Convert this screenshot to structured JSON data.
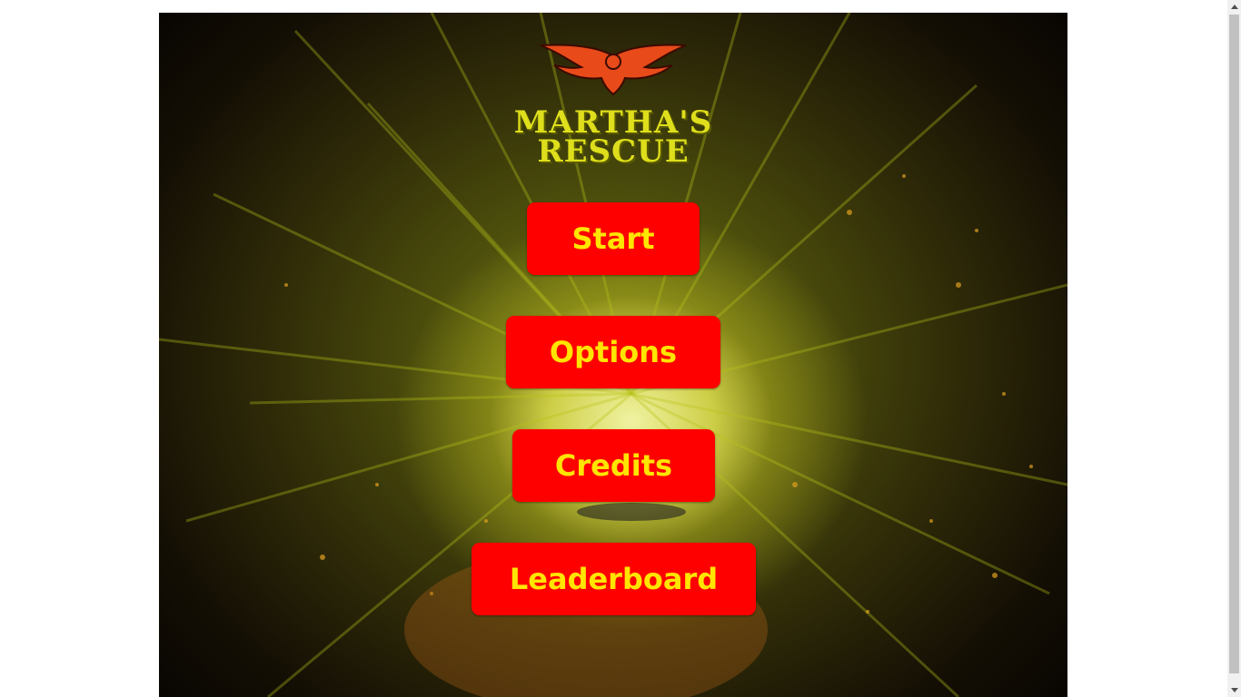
{
  "logo": {
    "line1": "MARTHA'S",
    "line2": "RESCUE",
    "icon": "eagle-emblem-icon"
  },
  "menu": {
    "start_label": "Start",
    "options_label": "Options",
    "credits_label": "Credits",
    "leaderboard_label": "Leaderboard"
  },
  "colors": {
    "button_bg": "#ff0000",
    "button_text": "#ffe500",
    "logo_text": "#dede1c",
    "emblem": "#e84a1a"
  },
  "scrollbar": {
    "up_icon": "scroll-up-arrow-icon",
    "down_icon": "scroll-down-arrow-icon"
  }
}
